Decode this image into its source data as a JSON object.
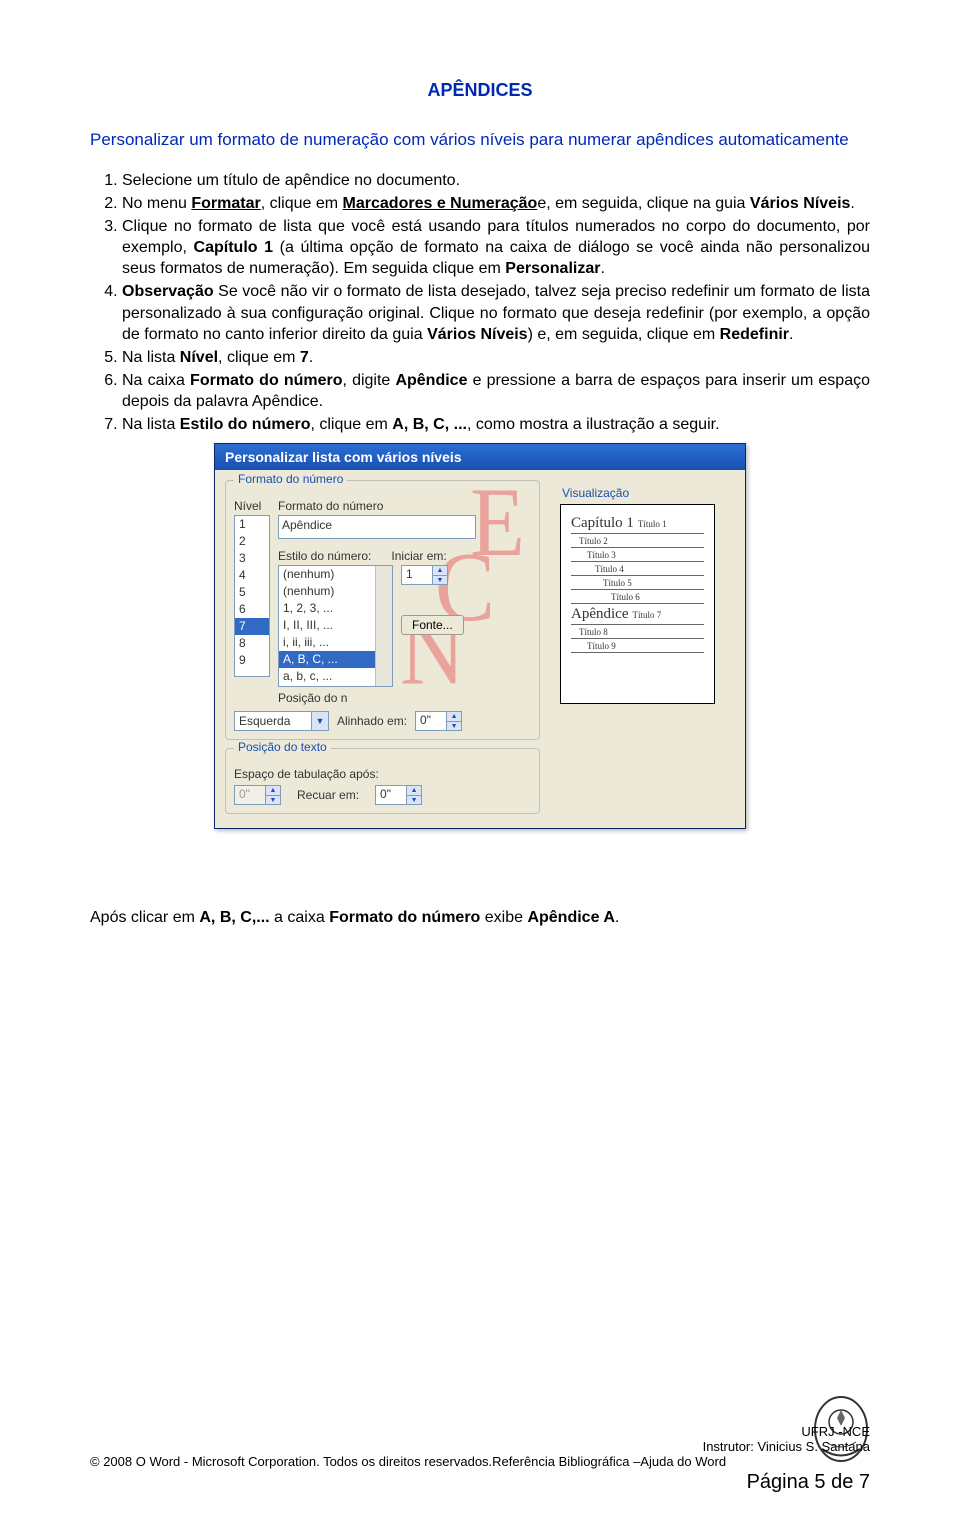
{
  "title": "APÊNDICES",
  "subtitle": "Personalizar um formato de numeração com vários níveis para numerar apêndices automaticamente",
  "steps": {
    "s1": "Selecione um título de apêndice no documento.",
    "s2_a": "No menu ",
    "s2_b": "Formatar",
    "s2_c": ", clique em ",
    "s2_d": "Marcadores e Numeração",
    "s2_e": "e, em seguida, clique na guia ",
    "s2_f": "Vários Níveis",
    "s2_g": ".",
    "s3_a": "Clique no formato de lista que você está usando para títulos numerados no corpo do documento, por exemplo, ",
    "s3_b": "Capítulo 1",
    "s3_c": " (a última opção de formato na caixa de diálogo se você ainda não personalizou seus formatos de numeração). Em seguida clique em ",
    "s3_d": "Personalizar",
    "s3_e": ".",
    "s4_a": "Observação",
    "s4_b": "  Se você não vir o formato de lista desejado, talvez seja preciso redefinir um formato de lista personalizado à sua configuração original. Clique no formato que deseja redefinir (por exemplo, a opção de formato no canto inferior direito da guia ",
    "s4_c": "Vários Níveis",
    "s4_d": ") e, em seguida, clique em ",
    "s4_e": "Redefinir",
    "s4_f": ".",
    "s5_a": "Na lista ",
    "s5_b": "Nível",
    "s5_c": ", clique em ",
    "s5_d": "7",
    "s5_e": ".",
    "s6_a": "Na caixa ",
    "s6_b": "Formato do número",
    "s6_c": ", digite ",
    "s6_d": "Apêndice",
    "s6_e": " e pressione a barra de espaços para inserir um espaço depois da palavra Apêndice.",
    "s7_a": "Na lista ",
    "s7_b": "Estilo do número",
    "s7_c": ", clique em ",
    "s7_d": "A, B, C, ...",
    "s7_e": ", como mostra a ilustração a seguir."
  },
  "dialog": {
    "title": "Personalizar lista com vários níveis",
    "group_formato": "Formato do número",
    "lbl_nivel": "Nível",
    "nivel_items": [
      "1",
      "2",
      "3",
      "4",
      "5",
      "6",
      "7",
      "8",
      "9"
    ],
    "nivel_selected": "7",
    "lbl_formato": "Formato do número",
    "txt_formato": "Apêndice",
    "dropdown_items": [
      "(nenhum)",
      "(nenhum)",
      "1, 2, 3, ...",
      "I, II, III, ...",
      "i, ii, iii, ...",
      "A, B, C, ...",
      "a, b, c, ..."
    ],
    "dropdown_highlight": "A, B, C, ...",
    "lbl_estilo": "Estilo do número:",
    "lbl_iniciar": "Iniciar em:",
    "val_iniciar": "1",
    "btn_fonte": "Fonte...",
    "lbl_posicao_tail": "Posição do n",
    "group_visual": "Visualização",
    "preview": [
      {
        "big": "Capítulo 1",
        "small": "Título 1"
      },
      {
        "big": "",
        "small": "Título 2"
      },
      {
        "big": "",
        "small": "Título 3"
      },
      {
        "big": "",
        "small": "Título 4"
      },
      {
        "big": "",
        "small": "Título 5"
      },
      {
        "big": "",
        "small": "Título 6"
      },
      {
        "big": "Apêndice",
        "small": "Título 7"
      },
      {
        "big": "",
        "small": "Título 8"
      },
      {
        "big": "",
        "small": "Título 9"
      }
    ],
    "combo_esquerda": "Esquerda",
    "lbl_alinhado": "Alinhado em:",
    "val_alinhado": "0\"",
    "group_postexto": "Posição do texto",
    "lbl_espaco": "Espaço de tabulação após:",
    "val_espaco": "0\"",
    "lbl_recuar": "Recuar em:",
    "val_recuar": "0\""
  },
  "after_dialog_a": "Após clicar em ",
  "after_dialog_b": "A, B, C,...",
  "after_dialog_c": " a caixa ",
  "after_dialog_d": "Formato do número",
  "after_dialog_e": " exibe ",
  "after_dialog_f": "Apêndice A",
  "after_dialog_g": ".",
  "footer": {
    "ufrj": "UFRJ -NCE",
    "instrutor": "Instrutor: Vinicius S. Santana",
    "copyright": "© 2008 O Word - Microsoft Corporation. Todos os direitos reservados.Referência Bibliográfica –Ajuda do Word",
    "page": "Página 5 de 7"
  },
  "watermark_letters": [
    "E",
    "C",
    "N"
  ]
}
